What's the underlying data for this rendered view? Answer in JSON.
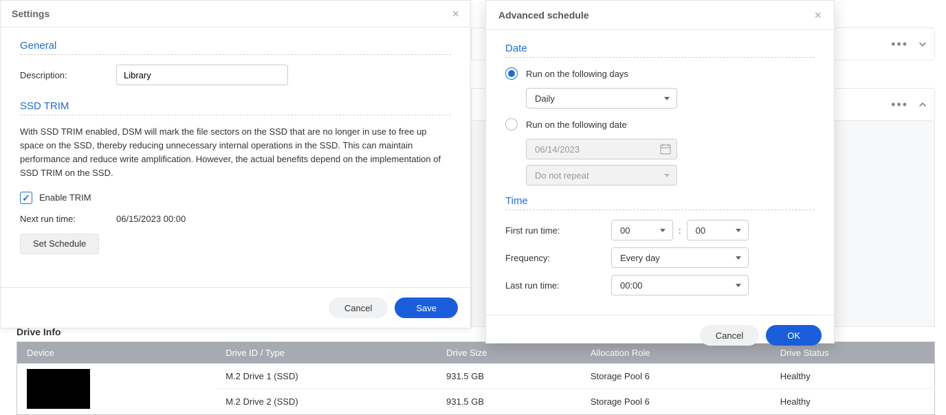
{
  "settings": {
    "title": "Settings",
    "general": {
      "heading": "General",
      "description_label": "Description:",
      "description_value": "Library"
    },
    "trim": {
      "heading": "SSD TRIM",
      "help": "With SSD TRIM enabled, DSM will mark the file sectors on the SSD that are no longer in use to free up space on the SSD, thereby reducing unnecessary internal operations in the SSD. This can maintain performance and reduce write amplification. However, the actual benefits depend on the implementation of SSD TRIM on the SSD.",
      "enable_label": "Enable TRIM",
      "next_run_label": "Next run time:",
      "next_run_value": "06/15/2023 00:00",
      "set_schedule": "Set Schedule"
    },
    "footer": {
      "cancel": "Cancel",
      "save": "Save"
    }
  },
  "schedule": {
    "title": "Advanced schedule",
    "date": {
      "heading": "Date",
      "run_days_label": "Run on the following days",
      "days_select_value": "Daily",
      "run_date_label": "Run on the following date",
      "date_value": "06/14/2023",
      "repeat_value": "Do not repeat"
    },
    "time": {
      "heading": "Time",
      "first_run_label": "First run time:",
      "hour": "00",
      "minute": "00",
      "frequency_label": "Frequency:",
      "frequency_value": "Every day",
      "last_run_label": "Last run time:",
      "last_run_value": "00:00"
    },
    "footer": {
      "cancel": "Cancel",
      "ok": "OK"
    }
  },
  "drives": {
    "heading": "Drive Info",
    "columns": {
      "device": "Device",
      "id": "Drive ID / Type",
      "size": "Drive Size",
      "role": "Allocation Role",
      "status": "Drive Status"
    },
    "rows": [
      {
        "id": "M.2 Drive 1 (SSD)",
        "size": "931.5 GB",
        "role": "Storage Pool 6",
        "status": "Healthy"
      },
      {
        "id": "M.2 Drive 2 (SSD)",
        "size": "931.5 GB",
        "role": "Storage Pool 6",
        "status": "Healthy"
      }
    ]
  }
}
